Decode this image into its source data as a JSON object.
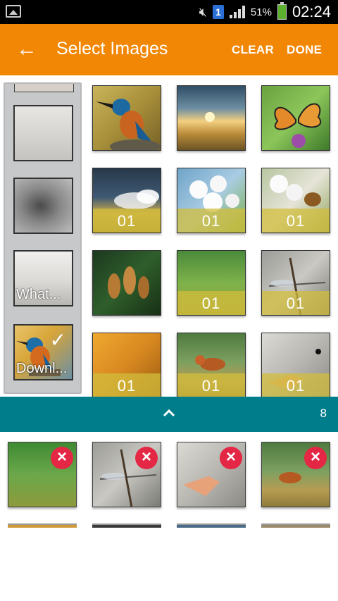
{
  "status_bar": {
    "badge": "1",
    "battery_percent": "51%",
    "time": "02:24",
    "icons": [
      "gallery-icon",
      "mute-icon",
      "signal-icon",
      "battery-icon"
    ]
  },
  "app_bar": {
    "back_icon": "arrow-left-icon",
    "title": "Select Images",
    "clear_label": "CLEAR",
    "done_label": "DONE",
    "color": "#f28705"
  },
  "side_panel": {
    "items": [
      {
        "label": ""
      },
      {
        "label": ""
      },
      {
        "label": "What..."
      },
      {
        "label": "Downl...",
        "selected": true
      }
    ]
  },
  "grid": {
    "items": [
      {
        "name": "kingfisher",
        "count": ""
      },
      {
        "name": "sunrise-fog",
        "count": ""
      },
      {
        "name": "butterfly",
        "count": ""
      },
      {
        "name": "storm-clouds",
        "count": "01"
      },
      {
        "name": "white-blossoms",
        "count": "01"
      },
      {
        "name": "bee-blossoms",
        "count": "01"
      },
      {
        "name": "pine-cones",
        "count": ""
      },
      {
        "name": "green-moss",
        "count": "01"
      },
      {
        "name": "dragonfly-web",
        "count": "01"
      },
      {
        "name": "yellow-leaves",
        "count": "01"
      },
      {
        "name": "fox-water",
        "count": "01"
      },
      {
        "name": "goose-beak",
        "count": "01"
      }
    ]
  },
  "bottom_bar": {
    "chevron_icon": "chevron-up-icon",
    "selected_count": "8",
    "color": "#007d8b"
  },
  "selected_tray": {
    "items": [
      {
        "name": "green-moss"
      },
      {
        "name": "dragonfly-web"
      },
      {
        "name": "goose-beak"
      },
      {
        "name": "fox-water"
      }
    ],
    "remove_icon": "close-icon",
    "remove_color": "#e32745"
  }
}
